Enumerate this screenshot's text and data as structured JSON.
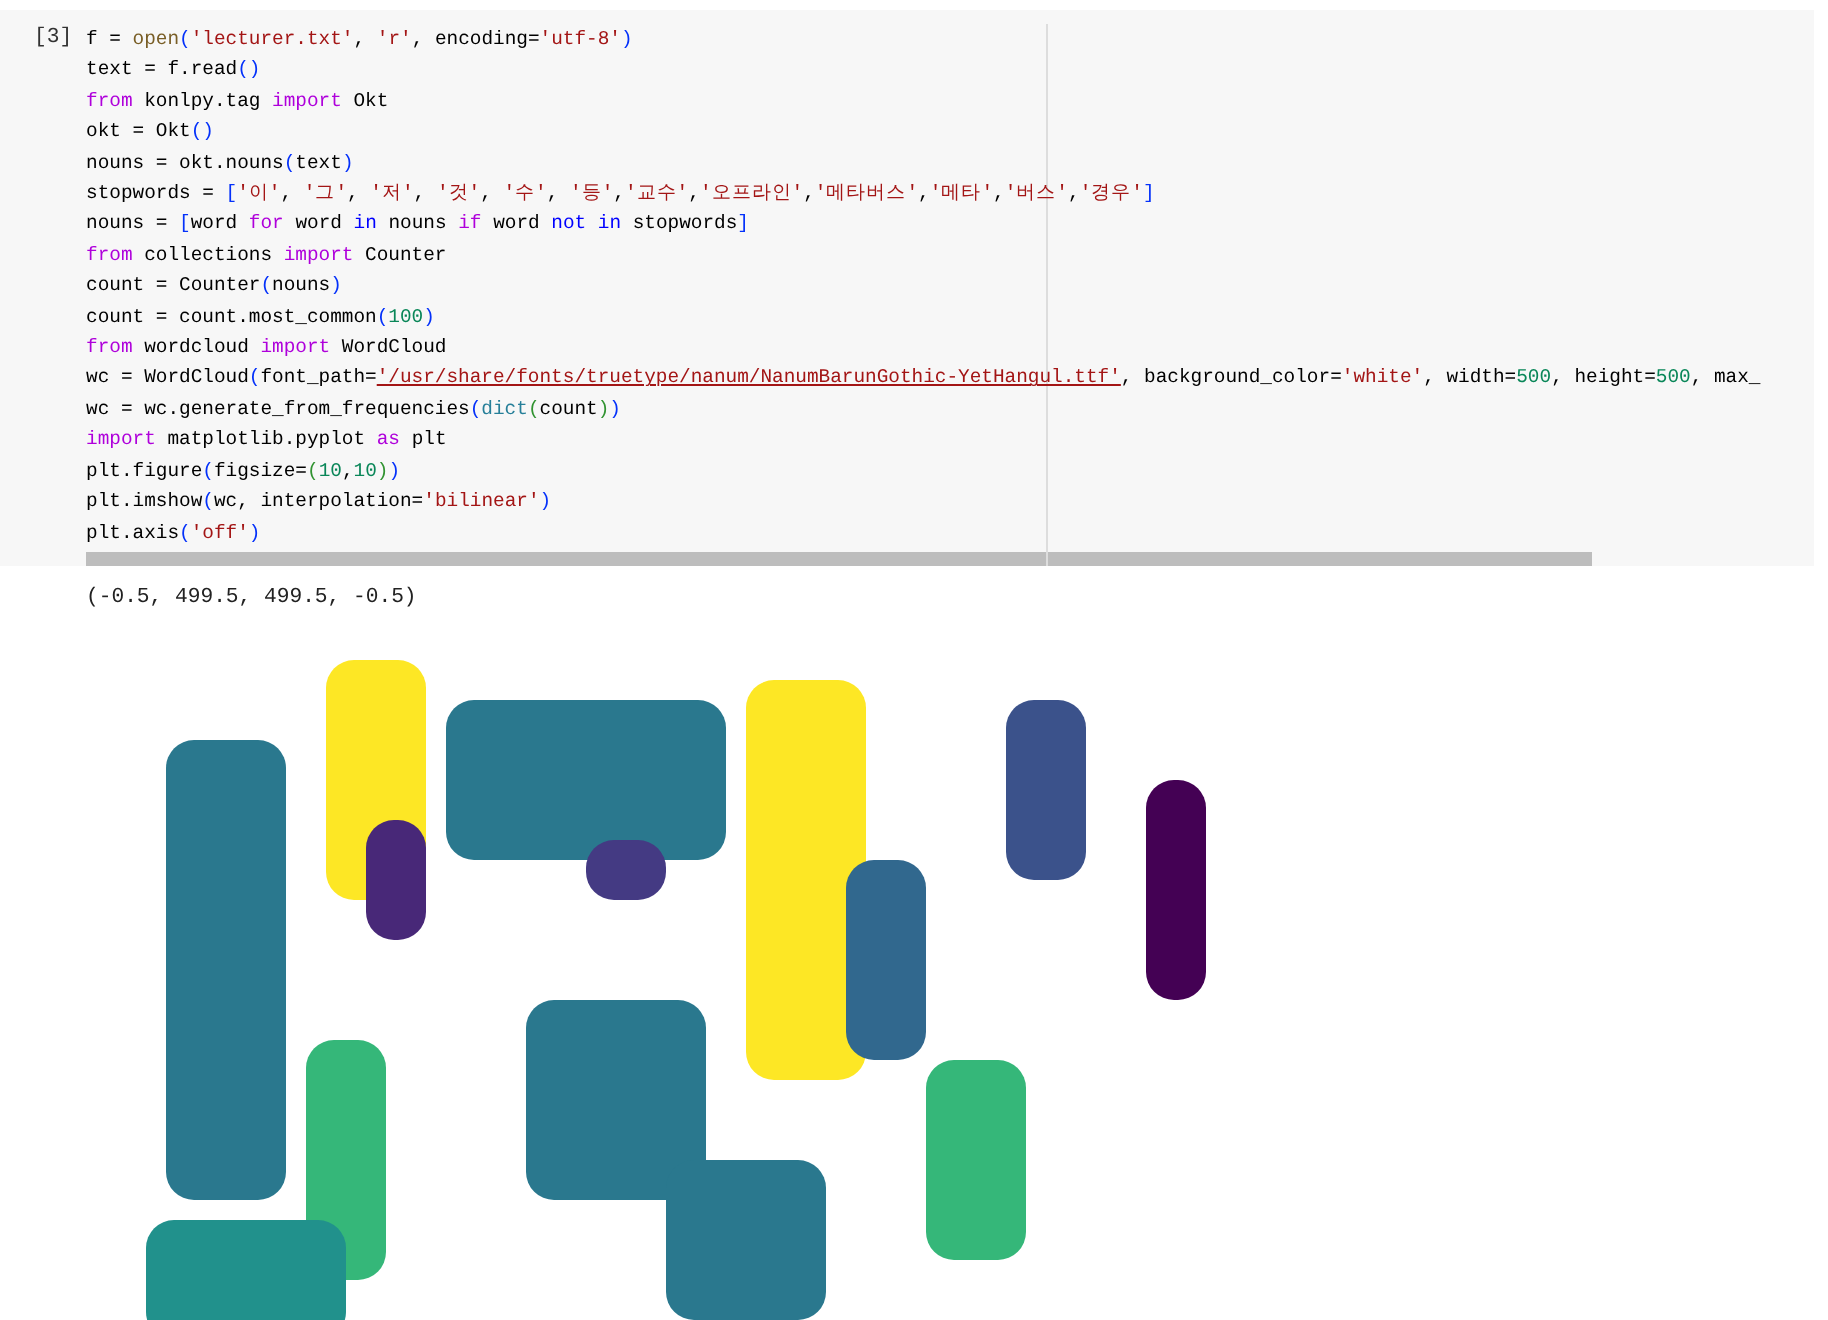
{
  "cell": {
    "prompt": "[3]",
    "lines": [
      [
        {
          "kind": "plain",
          "text": "f = "
        },
        {
          "kind": "fn",
          "text": "open"
        },
        {
          "kind": "paren",
          "text": "("
        },
        {
          "kind": "str",
          "text": "'lecturer.txt'"
        },
        {
          "kind": "plain",
          "text": ", "
        },
        {
          "kind": "str",
          "text": "'r'"
        },
        {
          "kind": "plain",
          "text": ", encoding="
        },
        {
          "kind": "str",
          "text": "'utf-8'"
        },
        {
          "kind": "paren",
          "text": ")"
        }
      ],
      [
        {
          "kind": "plain",
          "text": "text = f.read"
        },
        {
          "kind": "paren",
          "text": "()"
        }
      ],
      [
        {
          "kind": "kw",
          "text": "from"
        },
        {
          "kind": "plain",
          "text": " konlpy.tag "
        },
        {
          "kind": "kw",
          "text": "import"
        },
        {
          "kind": "plain",
          "text": " Okt"
        }
      ],
      [
        {
          "kind": "plain",
          "text": "okt = Okt"
        },
        {
          "kind": "paren",
          "text": "()"
        }
      ],
      [
        {
          "kind": "plain",
          "text": "nouns = okt.nouns"
        },
        {
          "kind": "paren",
          "text": "("
        },
        {
          "kind": "plain",
          "text": "text"
        },
        {
          "kind": "paren",
          "text": ")"
        }
      ],
      [
        {
          "kind": "plain",
          "text": "stopwords = "
        },
        {
          "kind": "paren",
          "text": "["
        },
        {
          "kind": "str",
          "text": "'이'"
        },
        {
          "kind": "plain",
          "text": ", "
        },
        {
          "kind": "str",
          "text": "'그'"
        },
        {
          "kind": "plain",
          "text": ", "
        },
        {
          "kind": "str",
          "text": "'저'"
        },
        {
          "kind": "plain",
          "text": ", "
        },
        {
          "kind": "str",
          "text": "'것'"
        },
        {
          "kind": "plain",
          "text": ", "
        },
        {
          "kind": "str",
          "text": "'수'"
        },
        {
          "kind": "plain",
          "text": ", "
        },
        {
          "kind": "str",
          "text": "'등'"
        },
        {
          "kind": "plain",
          "text": ","
        },
        {
          "kind": "str",
          "text": "'교수'"
        },
        {
          "kind": "plain",
          "text": ","
        },
        {
          "kind": "str",
          "text": "'오프라인'"
        },
        {
          "kind": "plain",
          "text": ","
        },
        {
          "kind": "str",
          "text": "'메타버스'"
        },
        {
          "kind": "plain",
          "text": ","
        },
        {
          "kind": "str",
          "text": "'메타'"
        },
        {
          "kind": "plain",
          "text": ","
        },
        {
          "kind": "str",
          "text": "'버스'"
        },
        {
          "kind": "plain",
          "text": ","
        },
        {
          "kind": "str",
          "text": "'경우'"
        },
        {
          "kind": "paren",
          "text": "]"
        }
      ],
      [
        {
          "kind": "plain",
          "text": "nouns = "
        },
        {
          "kind": "paren",
          "text": "["
        },
        {
          "kind": "plain",
          "text": "word "
        },
        {
          "kind": "kw",
          "text": "for"
        },
        {
          "kind": "plain",
          "text": " word "
        },
        {
          "kind": "op",
          "text": "in"
        },
        {
          "kind": "plain",
          "text": " nouns "
        },
        {
          "kind": "kw",
          "text": "if"
        },
        {
          "kind": "plain",
          "text": " word "
        },
        {
          "kind": "op",
          "text": "not in"
        },
        {
          "kind": "plain",
          "text": " stopwords"
        },
        {
          "kind": "paren",
          "text": "]"
        }
      ],
      [
        {
          "kind": "kw",
          "text": "from"
        },
        {
          "kind": "plain",
          "text": " collections "
        },
        {
          "kind": "kw",
          "text": "import"
        },
        {
          "kind": "plain",
          "text": " Counter"
        }
      ],
      [
        {
          "kind": "plain",
          "text": "count = Counter"
        },
        {
          "kind": "paren",
          "text": "("
        },
        {
          "kind": "plain",
          "text": "nouns"
        },
        {
          "kind": "paren",
          "text": ")"
        }
      ],
      [
        {
          "kind": "plain",
          "text": "count = count.most_common"
        },
        {
          "kind": "paren",
          "text": "("
        },
        {
          "kind": "num",
          "text": "100"
        },
        {
          "kind": "paren",
          "text": ")"
        }
      ],
      [
        {
          "kind": "kw",
          "text": "from"
        },
        {
          "kind": "plain",
          "text": " wordcloud "
        },
        {
          "kind": "kw",
          "text": "import"
        },
        {
          "kind": "plain",
          "text": " WordCloud"
        }
      ],
      [
        {
          "kind": "plain",
          "text": "wc = WordCloud"
        },
        {
          "kind": "paren",
          "text": "("
        },
        {
          "kind": "plain",
          "text": "font_path="
        },
        {
          "kind": "link",
          "text": "'/usr/share/fonts/truetype/nanum/NanumBarunGothic-YetHangul.ttf'"
        },
        {
          "kind": "plain",
          "text": ", background_color="
        },
        {
          "kind": "str",
          "text": "'white'"
        },
        {
          "kind": "plain",
          "text": ", width="
        },
        {
          "kind": "num",
          "text": "500"
        },
        {
          "kind": "plain",
          "text": ", height="
        },
        {
          "kind": "num",
          "text": "500"
        },
        {
          "kind": "plain",
          "text": ", max_"
        }
      ],
      [
        {
          "kind": "plain",
          "text": "wc = wc.generate_from_frequencies"
        },
        {
          "kind": "paren",
          "text": "("
        },
        {
          "kind": "builtin",
          "text": "dict"
        },
        {
          "kind": "paren2",
          "text": "("
        },
        {
          "kind": "plain",
          "text": "count"
        },
        {
          "kind": "paren2",
          "text": ")"
        },
        {
          "kind": "paren",
          "text": ")"
        }
      ],
      [
        {
          "kind": "kw",
          "text": "import"
        },
        {
          "kind": "plain",
          "text": " matplotlib.pyplot "
        },
        {
          "kind": "kw",
          "text": "as"
        },
        {
          "kind": "plain",
          "text": " plt"
        }
      ],
      [
        {
          "kind": "plain",
          "text": "plt.figure"
        },
        {
          "kind": "paren",
          "text": "("
        },
        {
          "kind": "plain",
          "text": "figsize="
        },
        {
          "kind": "paren2",
          "text": "("
        },
        {
          "kind": "num",
          "text": "10"
        },
        {
          "kind": "plain",
          "text": ","
        },
        {
          "kind": "num",
          "text": "10"
        },
        {
          "kind": "paren2",
          "text": ")"
        },
        {
          "kind": "paren",
          "text": ")"
        }
      ],
      [
        {
          "kind": "plain",
          "text": "plt.imshow"
        },
        {
          "kind": "paren",
          "text": "("
        },
        {
          "kind": "plain",
          "text": "wc, interpolation="
        },
        {
          "kind": "str",
          "text": "'bilinear'"
        },
        {
          "kind": "paren",
          "text": ")"
        }
      ],
      [
        {
          "kind": "plain",
          "text": "plt.axis"
        },
        {
          "kind": "paren",
          "text": "("
        },
        {
          "kind": "str",
          "text": "'off'"
        },
        {
          "kind": "paren",
          "text": ")"
        }
      ]
    ]
  },
  "output": {
    "text": "(-0.5, 499.5, 499.5, -0.5)"
  }
}
